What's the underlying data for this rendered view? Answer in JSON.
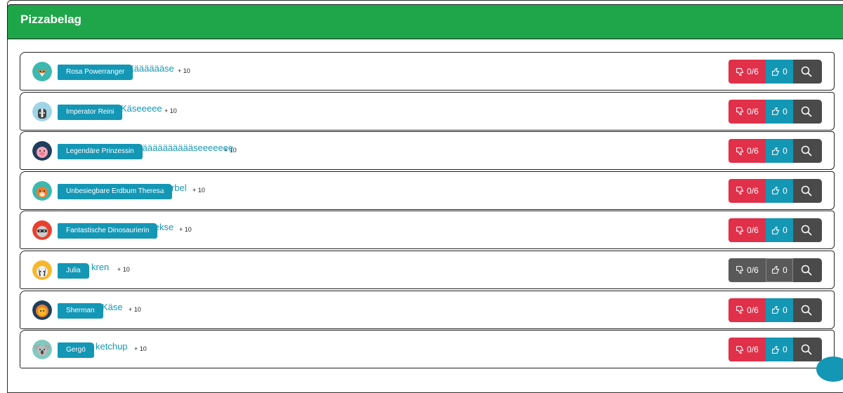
{
  "panel": {
    "title": "Pizzabelag"
  },
  "colors": {
    "header": "#1fa64a",
    "badge": "#1497b5",
    "dislike": "#e0304a",
    "like": "#1497b5",
    "search": "#4a4a4a",
    "disabled": "#595959"
  },
  "rows": [
    {
      "player": "Rosa Powerranger",
      "answer": "Kääääääse",
      "points": "+ 10",
      "dislikes": "0/6",
      "likes": "0",
      "avatar_icon": "fox-icon",
      "disabled": false
    },
    {
      "player": "Imperator Reini",
      "answer": "Käseeeee",
      "points": "+ 10",
      "dislikes": "0/6",
      "likes": "0",
      "avatar_icon": "skunk-icon",
      "disabled": false
    },
    {
      "player": "Legendäre Prinzessin",
      "answer": "Kääääääääääseeeeeee",
      "points": "+ 10",
      "dislikes": "0/6",
      "likes": "0",
      "avatar_icon": "pig-icon",
      "disabled": false
    },
    {
      "player": "Unbesiegbare Erdbum Theresa",
      "answer": "Kerbel",
      "points": "+ 10",
      "dislikes": "0/6",
      "likes": "0",
      "avatar_icon": "hamster-icon",
      "disabled": false
    },
    {
      "player": "Fantastische Dinosaurierin",
      "answer": "Kekse",
      "points": "+ 10",
      "dislikes": "0/6",
      "likes": "0",
      "avatar_icon": "raccoon-icon",
      "disabled": false
    },
    {
      "player": "Julia",
      "answer": "kren",
      "points": "+ 10",
      "dislikes": "0/6",
      "likes": "0",
      "avatar_icon": "badger-icon",
      "disabled": true
    },
    {
      "player": "Sherman",
      "answer": "Käse",
      "points": "+ 10",
      "dislikes": "0/6",
      "likes": "0",
      "avatar_icon": "lion-icon",
      "disabled": false
    },
    {
      "player": "Gergö",
      "answer": "ketchup",
      "points": "+ 10",
      "dislikes": "0/6",
      "likes": "0",
      "avatar_icon": "koala-icon",
      "disabled": false
    }
  ]
}
